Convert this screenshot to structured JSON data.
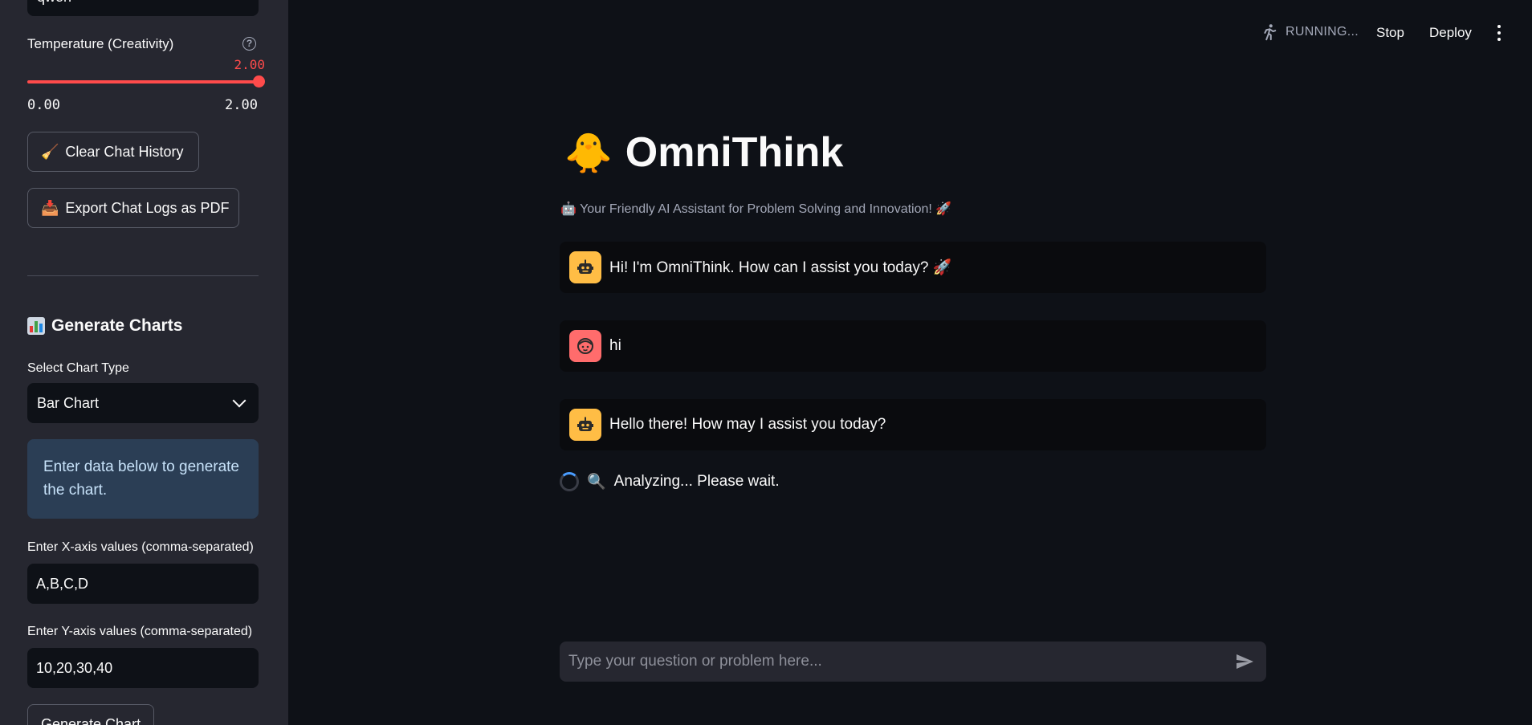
{
  "sidebar": {
    "model_value": "qwen",
    "temperature": {
      "label": "Temperature (Creativity)",
      "value": "2.00",
      "min": "0.00",
      "max": "2.00",
      "fraction": 1.0
    },
    "clear_button": "Clear Chat History",
    "export_button": "Export Chat Logs as PDF",
    "charts_title": "Generate Charts",
    "chart_type_label": "Select Chart Type",
    "chart_type_value": "Bar Chart",
    "info": "Enter data below to generate the chart.",
    "x_label": "Enter X-axis values (comma-separated)",
    "x_value": "A,B,C,D",
    "y_label": "Enter Y-axis values (comma-separated)",
    "y_value": "10,20,30,40",
    "generate_button": "Generate Chart"
  },
  "header": {
    "status": "RUNNING...",
    "stop": "Stop",
    "deploy": "Deploy"
  },
  "main": {
    "title": "OmniThink",
    "subtitle": "Your Friendly AI Assistant for Problem Solving and Innovation! 🚀",
    "messages": [
      {
        "role": "assistant",
        "text": "Hi! I'm OmniThink. How can I assist you today? 🚀"
      },
      {
        "role": "user",
        "text": "hi"
      },
      {
        "role": "assistant",
        "text": "Hello there! How may I assist you today?"
      }
    ],
    "spinner_text": "Analyzing... Please wait.",
    "chat_placeholder": "Type your question or problem here..."
  },
  "colors": {
    "accent": "#ff4b4b",
    "bot_avatar": "#ffbd45",
    "user_avatar": "#ff6c6c",
    "info_bg": "#2b3e55"
  }
}
